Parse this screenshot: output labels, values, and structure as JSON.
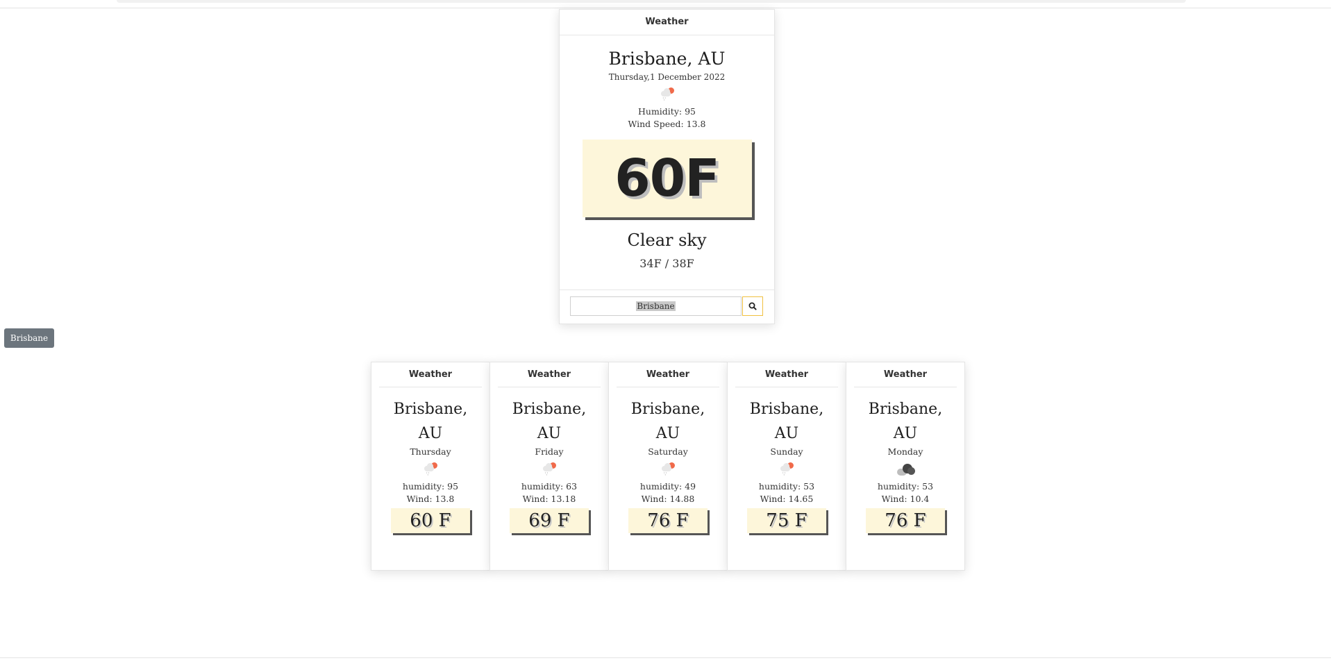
{
  "main": {
    "header": "Weather",
    "city": "Brisbane, AU",
    "date": "Thursday,1 December 2022",
    "icon": "rain-cloud-icon",
    "humidity": "Humidity: 95",
    "wind": "Wind Speed: 13.8",
    "temperature": "60F",
    "description": "Clear sky",
    "range": "34F / 38F",
    "search_value": "Brisbane"
  },
  "side_button": {
    "label": "Brisbane"
  },
  "forecast": [
    {
      "header": "Weather",
      "city_line1": "Brisbane,",
      "city_line2": "AU",
      "day": "Thursday",
      "icon": "rain-cloud-icon",
      "humidity": "humidity: 95",
      "wind": "Wind: 13.8",
      "temp": "60 F"
    },
    {
      "header": "Weather",
      "city_line1": "Brisbane,",
      "city_line2": "AU",
      "day": "Friday",
      "icon": "rain-cloud-icon",
      "humidity": "humidity: 63",
      "wind": "Wind: 13.18",
      "temp": "69 F"
    },
    {
      "header": "Weather",
      "city_line1": "Brisbane,",
      "city_line2": "AU",
      "day": "Saturday",
      "icon": "rain-cloud-icon",
      "humidity": "humidity: 49",
      "wind": "Wind: 14.88",
      "temp": "76 F"
    },
    {
      "header": "Weather",
      "city_line1": "Brisbane,",
      "city_line2": "AU",
      "day": "Sunday",
      "icon": "rain-cloud-icon",
      "humidity": "humidity: 53",
      "wind": "Wind: 14.65",
      "temp": "75 F"
    },
    {
      "header": "Weather",
      "city_line1": "Brisbane,",
      "city_line2": "AU",
      "day": "Monday",
      "icon": "broken-clouds-icon",
      "humidity": "humidity: 53",
      "wind": "Wind: 10.4",
      "temp": "76 F"
    }
  ],
  "colors": {
    "temp_box_bg": "#fdf6da",
    "search_button_border": "#f0c040",
    "side_button_bg": "#6c757d",
    "sun_accent": "#f06a4a"
  }
}
